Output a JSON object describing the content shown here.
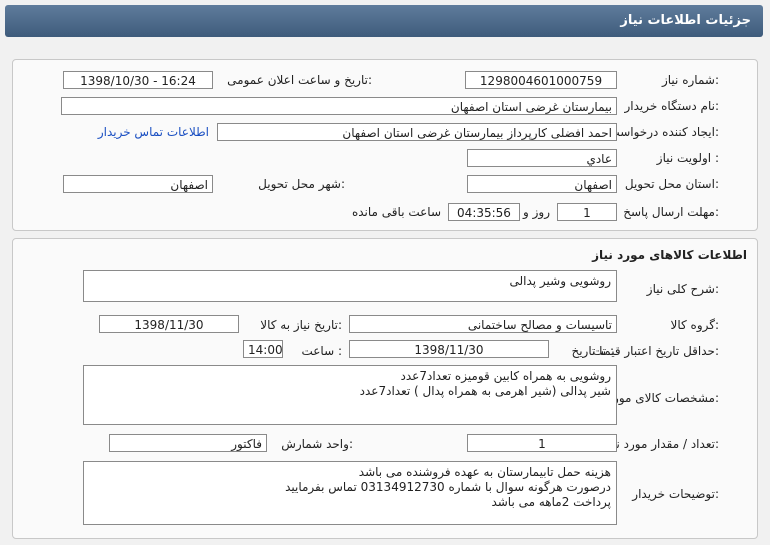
{
  "header": {
    "title": "جزئیات اطلاعات نیاز"
  },
  "info": {
    "need_number_label": "شماره نیاز:",
    "need_number": "1298004601000759",
    "announce_label": "تاریخ و ساعت اعلان عمومی:",
    "announce_value": "1398/10/30 - 16:24",
    "buyer_org_label": "نام دستگاه خریدار:",
    "buyer_org": "بیمارستان غرضی استان اصفهان",
    "creator_label": "ایجاد کننده درخواست:",
    "creator": "احمد افضلی کارپرداز بیمارستان غرضی استان اصفهان",
    "contact_link": "اطلاعات تماس خریدار",
    "priority_label": "اولویت نیاز :",
    "priority": "عادي",
    "province_label": "استان محل تحویل:",
    "province": "اصفهان",
    "city_label": "شهر محل تحویل:",
    "city": "اصفهان",
    "deadline_label": "مهلت ارسال پاسخ:",
    "deadline_days": "1",
    "day_and_label": "روز و",
    "deadline_time": "04:35:56",
    "remaining_label": "ساعت باقی مانده"
  },
  "goods": {
    "title": "اطلاعات کالاهای مورد نیاز",
    "summary_label": "شرح کلی نیاز:",
    "summary": "روشویی وشیر پدالی",
    "group_label": "گروه کالا:",
    "group": "تاسیسات و مصالح ساختمانی",
    "need_date_label": "تاریخ نیاز به کالا:",
    "need_date": "1398/11/30",
    "validity_label": "حداقل تاریخ اعتبار قیمت:",
    "until_label": "تا تاریخ :",
    "validity_date": "1398/11/30",
    "time_label": "ساعت :",
    "validity_time": "14:00",
    "spec_label": "مشخصات کالای مورد نیاز:",
    "spec_lines": [
      "روشویی به همراه کابین قومیزه تعداد7عدد",
      "شیر پدالی (شیر اهرمی به همراه پدال ) تعداد7عدد"
    ],
    "qty_label": "تعداد / مقدار مورد نیاز:",
    "qty": "1",
    "unit_label": "واحد شمارش:",
    "unit": "فاکتور",
    "buyer_notes_label": "توضیحات خریدار:",
    "notes_lines": [
      "هزینه حمل تابیمارستان به عهده فروشنده می باشد",
      "درصورت هرگونه سوال با شماره 03134912730 تماس بفرمایید",
      "پرداخت 2ماهه می باشد"
    ]
  },
  "colors": {
    "header": "#4a6888",
    "link": "#1a4fc2"
  }
}
